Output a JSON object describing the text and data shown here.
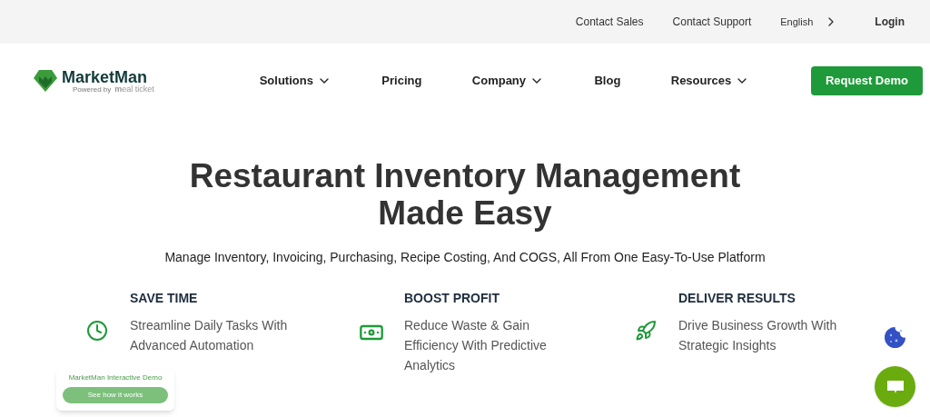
{
  "top_bar": {
    "links": [
      "Contact Sales",
      "Contact Support"
    ],
    "language": "English",
    "login": "Login"
  },
  "logo": {
    "name": "MarketMan",
    "powered_by": "Powered by",
    "partner": "**m**eal ticket"
  },
  "nav": [
    {
      "label": "Solutions",
      "has_menu": true
    },
    {
      "label": "Pricing",
      "has_menu": false
    },
    {
      "label": "Company",
      "has_menu": true
    },
    {
      "label": "Blog",
      "has_menu": false
    },
    {
      "label": "Resources",
      "has_menu": true
    }
  ],
  "cta": "Request Demo",
  "hero": {
    "title_lines": [
      "Restaurant Inventory Management",
      "Made Easy"
    ],
    "subtitle": "Manage Inventory, Invoicing, Purchasing, Recipe Costing, And COGS, All From One Easy-To-Use Platform"
  },
  "features": [
    {
      "kind": "clock",
      "title": "SAVE TIME",
      "text": "Streamline Daily Tasks With Advanced Automation"
    },
    {
      "kind": "money",
      "title": "BOOST PROFIT",
      "text": "Reduce Waste & Gain Efficiency With Predictive Analytics"
    },
    {
      "kind": "rocket",
      "title": "DELIVER RESULTS",
      "text": "Drive Business Growth With Strategic Insights"
    }
  ],
  "demo_widget": {
    "title": "MarketMan Interactive Demo",
    "button": "See how it works"
  }
}
